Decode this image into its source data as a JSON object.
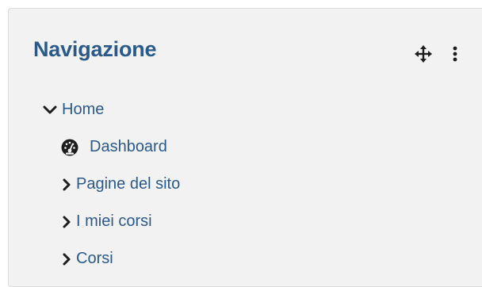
{
  "block": {
    "title": "Navigazione",
    "controls": {
      "move_icon": "move-arrows-icon",
      "menu_icon": "vertical-ellipsis-icon"
    }
  },
  "tree": {
    "home": {
      "label": "Home",
      "icon": "chevron-down-icon",
      "expanded": true
    },
    "children": [
      {
        "label": "Dashboard",
        "icon": "dashboard-gauge-icon"
      },
      {
        "label": "Pagine del sito",
        "icon": "chevron-right-icon"
      },
      {
        "label": "I miei corsi",
        "icon": "chevron-right-icon"
      },
      {
        "label": "Corsi",
        "icon": "chevron-right-icon"
      }
    ]
  },
  "colors": {
    "accent": "#2a5a8a",
    "panel_background": "#f2f2f2",
    "panel_border": "#dcdcdc",
    "icon_dark": "#1d1d1d"
  }
}
